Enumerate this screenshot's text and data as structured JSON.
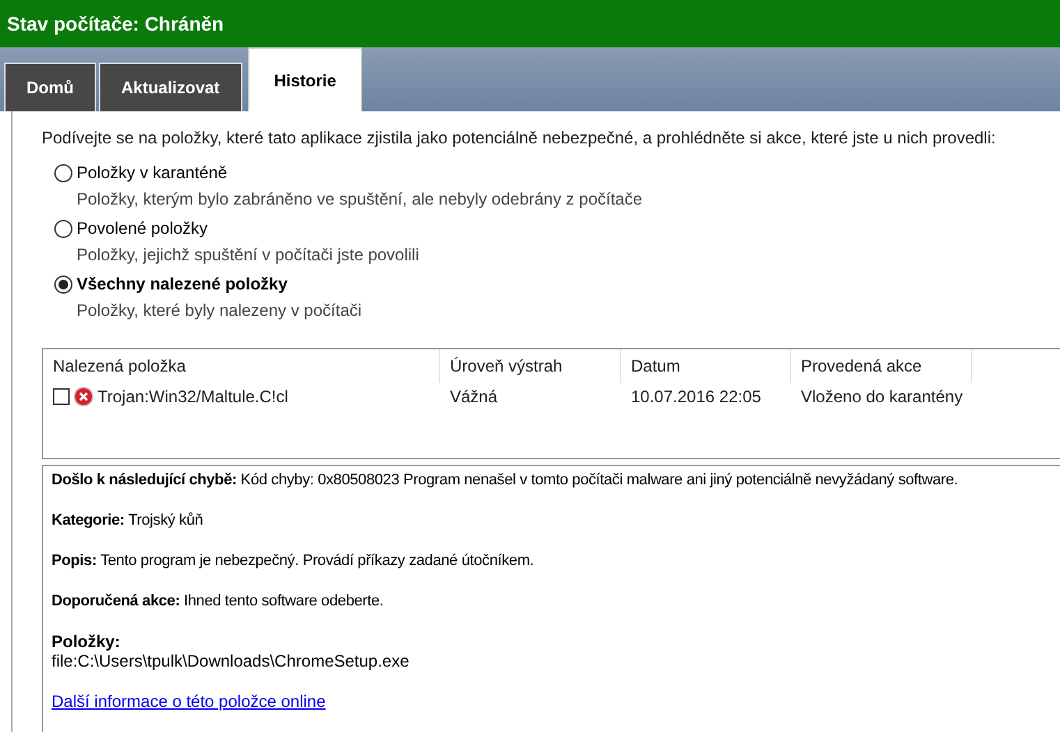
{
  "window": {
    "title": "Stav počítače: Chráněn"
  },
  "tabs": [
    {
      "label": "Domů",
      "selected": false
    },
    {
      "label": "Aktualizovat",
      "selected": false
    },
    {
      "label": "Historie",
      "selected": true
    }
  ],
  "intro": "Podívejte se na položky, které tato aplikace zjistila jako potenciálně nebezpečné, a prohlédněte si akce, které jste u nich provedli:",
  "filters": [
    {
      "label": "Položky v karanténě",
      "description": "Položky, kterým bylo zabráněno ve spuštění, ale nebyly odebrány z počítače",
      "selected": false
    },
    {
      "label": "Povolené položky",
      "description": "Položky, jejichž spuštění v počítači jste povolili",
      "selected": false
    },
    {
      "label": "Všechny nalezené položky",
      "description": "Položky, které byly nalezeny v počítači",
      "selected": true
    }
  ],
  "table": {
    "columns": [
      "Nalezená položka",
      "Úroveň výstrah",
      "Datum",
      "Provedená akce"
    ],
    "rows": [
      {
        "checked": false,
        "cells": [
          "Trojan:Win32/Maltule.C!cl",
          "Vážná",
          "10.07.2016 22:05",
          "Vloženo do karantény"
        ]
      }
    ]
  },
  "details": {
    "paragraphs": [
      "**Došlo k následující chybě:** Kód chyby: 0x80508023 Program nenašel v tomto počítači malware ani jiný potenciálně nevyžádaný software.",
      "**Kategorie:** Trojský kůň",
      "**Popis:** Tento program je nebezpečný. Provádí příkazy zadané útočníkem.",
      "**Doporučená akce:** Ihned tento software odeberte."
    ],
    "items_label": "Položky:",
    "item_path": "file:C:\\Users\\tpulk\\Downloads\\ChromeSetup.exe",
    "link": "Další informace o této položce online"
  }
}
